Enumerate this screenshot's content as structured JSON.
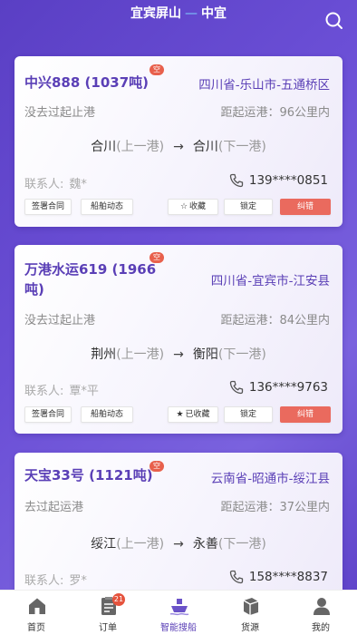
{
  "header": {
    "route_from": "宜宾屏山",
    "route_to": "中宜",
    "route_sep": "—"
  },
  "common": {
    "contact_label": "联系人:",
    "arrow": "→",
    "prev_port_suffix": "(上一港)",
    "next_port_suffix": "(下一港)",
    "tag_label": "空"
  },
  "cards": [
    {
      "ship": "中兴888 (1037吨)",
      "location": "四川省-乐山市-五通桥区",
      "status": "没去过起止港",
      "distance": "距起运港：96公里内",
      "prev_port": "合川",
      "next_port": "合川",
      "contact_name": "魏*",
      "phone": "139****0851",
      "actions": {
        "contract": "签署合同",
        "dynamics": "船舶动态",
        "favorite": "收藏",
        "favorite_icon": "star-outline-icon",
        "lock": "锁定",
        "correct": "纠错"
      }
    },
    {
      "ship": "万港水运619 (1966吨)",
      "location": "四川省-宜宾市-江安县",
      "status": "没去过起止港",
      "distance": "距起运港：84公里内",
      "prev_port": "荆州",
      "next_port": "衡阳",
      "contact_name": "覃*平",
      "phone": "136****9763",
      "actions": {
        "contract": "签署合同",
        "dynamics": "船舶动态",
        "favorite": "已收藏",
        "favorite_icon": "star-filled-icon",
        "lock": "锁定",
        "correct": "纠错"
      }
    },
    {
      "ship": "天宝33号 (1121吨)",
      "location": "云南省-昭通市-绥江县",
      "status": "去过起运港",
      "distance": "距起运港：37公里内",
      "prev_port": "绥江",
      "next_port": "永善",
      "contact_name": "罗*",
      "phone": "158****8837"
    }
  ],
  "tabbar": {
    "items": [
      {
        "label": "首页",
        "icon": "home-icon"
      },
      {
        "label": "订单",
        "icon": "order-icon",
        "badge": "21"
      },
      {
        "label": "智能搜船",
        "icon": "ship-icon",
        "active": true
      },
      {
        "label": "货源",
        "icon": "cargo-icon"
      },
      {
        "label": "我的",
        "icon": "profile-icon"
      }
    ]
  },
  "colors": {
    "accent": "#5a3fb6",
    "background": "#6b4fd6",
    "danger": "#ea6a5e",
    "badge": "#e5533d"
  }
}
